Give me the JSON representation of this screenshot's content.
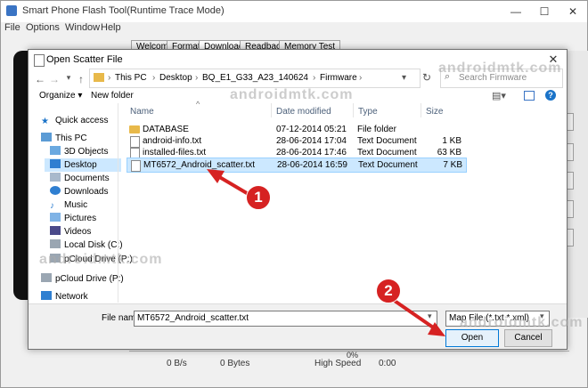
{
  "app": {
    "title": "Smart Phone Flash Tool(Runtime Trace Mode)",
    "window_controls": {
      "minimize": "—",
      "maximize": "☐",
      "close": "✕"
    },
    "menu": [
      "File",
      "Options",
      "Window",
      "Help"
    ],
    "tabs": [
      "Welcome",
      "Format",
      "Download",
      "Readback",
      "Memory Test"
    ],
    "status": {
      "percent": "0%",
      "speed": "0 B/s",
      "bytes": "0 Bytes",
      "mode": "High Speed",
      "time": "0:00"
    }
  },
  "dialog": {
    "title": "Open Scatter File",
    "close": "✕",
    "breadcrumbs": [
      "This PC",
      "Desktop",
      "BQ_E1_G33_A23_140624",
      "Firmware"
    ],
    "search_placeholder": "Search Firmware",
    "toolbar": {
      "organize": "Organize ▾",
      "new_folder": "New folder"
    },
    "nav": [
      {
        "label": "Quick access",
        "icon": "star-icon"
      },
      {
        "label": "This PC",
        "icon": "computer-icon"
      },
      {
        "label": "3D Objects",
        "icon": "cube-icon"
      },
      {
        "label": "Desktop",
        "icon": "desktop-icon"
      },
      {
        "label": "Documents",
        "icon": "document-icon"
      },
      {
        "label": "Downloads",
        "icon": "download-icon"
      },
      {
        "label": "Music",
        "icon": "music-icon"
      },
      {
        "label": "Pictures",
        "icon": "picture-icon"
      },
      {
        "label": "Videos",
        "icon": "video-icon"
      },
      {
        "label": "Local Disk (C:)",
        "icon": "disk-icon"
      },
      {
        "label": "pCloud Drive (P:)",
        "icon": "drive-icon"
      },
      {
        "label": "pCloud Drive (P:)",
        "icon": "drive-icon"
      },
      {
        "label": "Network",
        "icon": "network-icon"
      }
    ],
    "columns": [
      "Name",
      "Date modified",
      "Type",
      "Size"
    ],
    "files": [
      {
        "name": "DATABASE",
        "date": "07-12-2014 05:21",
        "type": "File folder",
        "size": ""
      },
      {
        "name": "android-info.txt",
        "date": "28-06-2014 17:04",
        "type": "Text Document",
        "size": "1 KB"
      },
      {
        "name": "installed-files.txt",
        "date": "28-06-2014 17:46",
        "type": "Text Document",
        "size": "63 KB"
      },
      {
        "name": "MT6572_Android_scatter.txt",
        "date": "28-06-2014 16:59",
        "type": "Text Document",
        "size": "7 KB"
      }
    ],
    "file_name_label": "File name:",
    "file_name_value": "MT6572_Android_scatter.txt",
    "filter_value": "Map File (*.txt *.xml)",
    "open_label": "Open",
    "cancel_label": "Cancel"
  },
  "annotations": {
    "step1": "1",
    "step2": "2",
    "arrow_color": "#d62222"
  },
  "watermark": "androidmtk.com"
}
